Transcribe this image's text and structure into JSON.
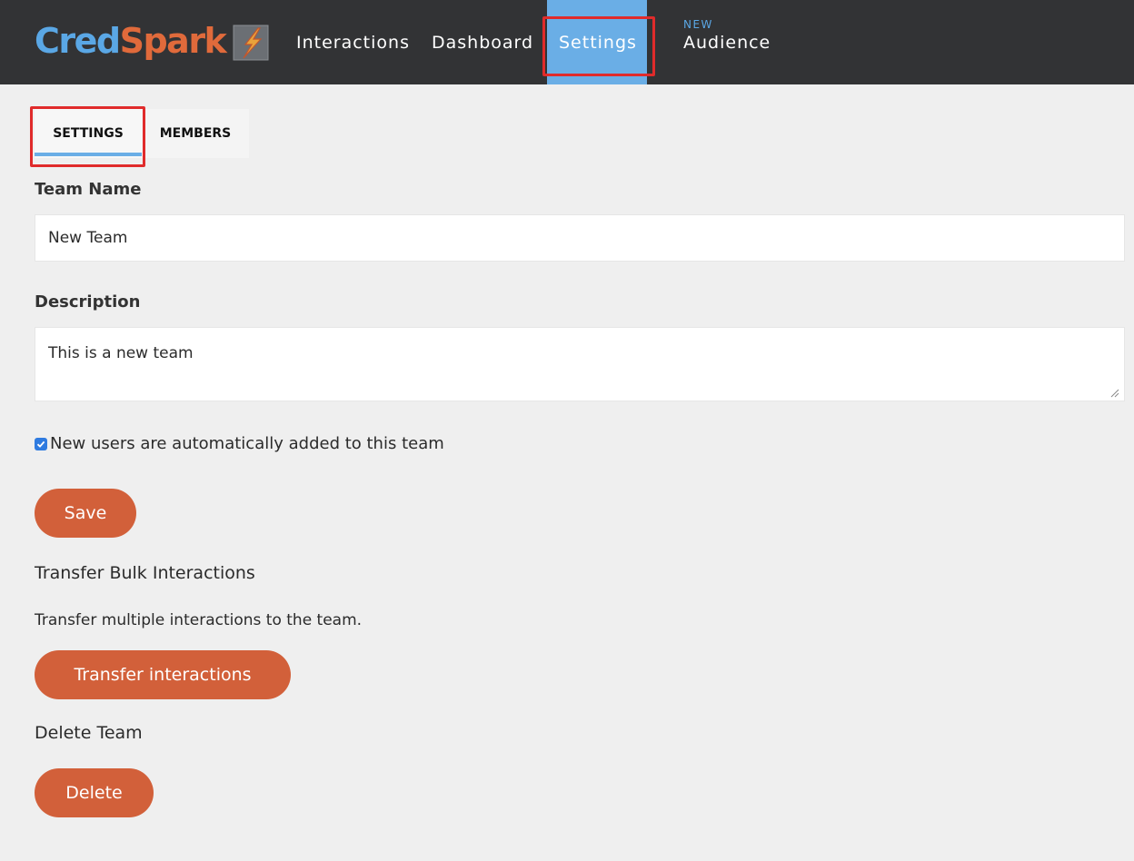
{
  "brand": {
    "name_part1": "Cred",
    "name_part2": "Spark",
    "logo_icon": "lightning-bolt-icon",
    "colors": {
      "cred": "#5aa7e5",
      "spark": "#e06a3b"
    }
  },
  "nav": {
    "items": [
      {
        "label": "Interactions"
      },
      {
        "label": "Dashboard"
      },
      {
        "label": "Settings",
        "active": true
      },
      {
        "label": "Audience",
        "badge": "NEW"
      }
    ],
    "active_color": "#6aaee6",
    "background": "#323335"
  },
  "tabs": [
    {
      "label": "SETTINGS",
      "active": true
    },
    {
      "label": "MEMBERS",
      "active": false
    }
  ],
  "form": {
    "team_name_label": "Team Name",
    "team_name_value": "New Team",
    "description_label": "Description",
    "description_value": "This is a new team",
    "auto_add_label": "New users are automatically added to this team",
    "auto_add_checked": true,
    "save_label": "Save"
  },
  "transfer": {
    "heading": "Transfer Bulk Interactions",
    "description": "Transfer multiple interactions to the team.",
    "button_label": "Transfer interactions"
  },
  "delete": {
    "heading": "Delete Team",
    "button_label": "Delete"
  },
  "accent_color": "#d2603a",
  "highlight_color": "#e02b2b"
}
